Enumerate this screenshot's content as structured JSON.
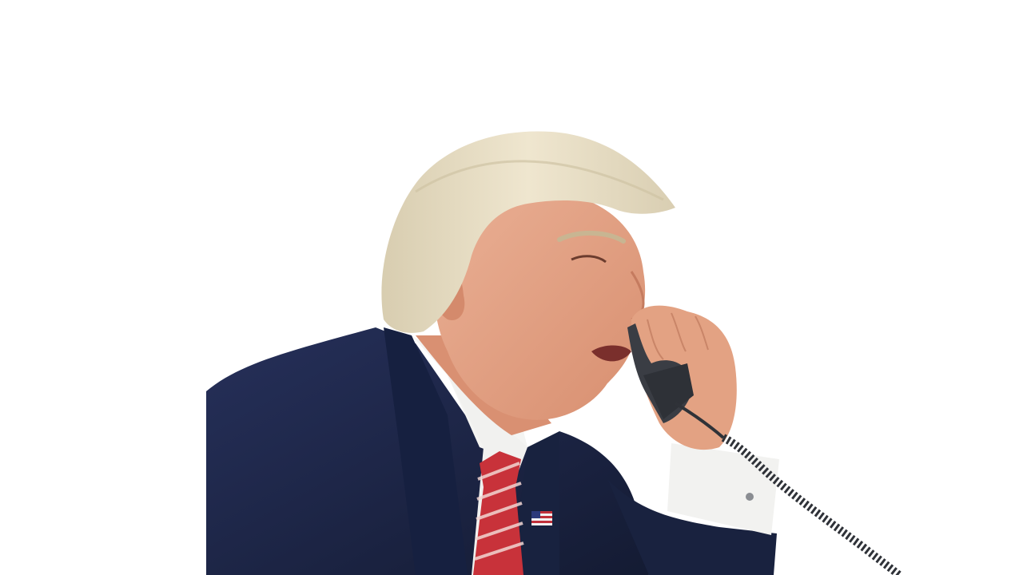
{
  "image": {
    "background_color": "#ffffff",
    "subject": "person-on-phone-cutout",
    "colors": {
      "suit": "#1c2540",
      "suit_shadow": "#121a30",
      "shirt": "#f4f4f2",
      "tie_red": "#c8323a",
      "tie_stripe": "#f2d6d2",
      "skin": "#e8a585",
      "skin_shadow": "#cf8a6c",
      "hair": "#e6dcc2",
      "hair_shadow": "#cfc3a4",
      "phone": "#3a3d44",
      "cord": "#2f3238",
      "flag_red": "#c0303a",
      "flag_blue": "#2c3a7a"
    }
  }
}
